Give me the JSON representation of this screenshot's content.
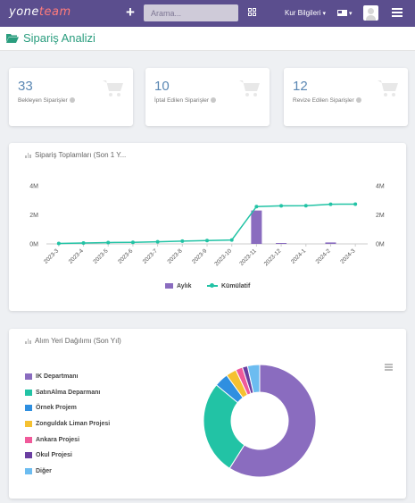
{
  "header": {
    "logo_part1": "yone",
    "logo_part2": "team",
    "search_placeholder": "Arama...",
    "company_menu": "Kur Bilgileri",
    "colors": {
      "topbar": "#5b4e8e",
      "accent": "#2a9d7e"
    }
  },
  "page": {
    "title": "Sipariş Analizi",
    "icon": "folder-open-icon"
  },
  "stats": [
    {
      "value": "33",
      "label": "Bekleyen Siparişler"
    },
    {
      "value": "10",
      "label": "İptal Edilen Siparişler"
    },
    {
      "value": "12",
      "label": "Revize Edilen Siparişler"
    }
  ],
  "order_chart": {
    "title": "Sipariş Toplamları (Son 1 Y...",
    "legend_monthly": "Aylık",
    "legend_cumulative": "Kümülatif"
  },
  "pie_chart": {
    "title": "Alım Yeri Dağılımı (Son Yıl)"
  },
  "chart_data": [
    {
      "type": "bar",
      "title": "Sipariş Toplamları (Son 1 Y...",
      "categories": [
        "2023-3",
        "2023-4",
        "2023-5",
        "2023-6",
        "2023-7",
        "2023-8",
        "2023-9",
        "2023-10",
        "2023-11",
        "2023-12",
        "2024-1",
        "2024-2",
        "2024-3"
      ],
      "y_ticks": [
        "0M",
        "2M",
        "4M"
      ],
      "ylim": [
        0,
        4000000
      ],
      "grid": false,
      "legend_position": "bottom",
      "series": [
        {
          "name": "Aylık",
          "type": "bar",
          "color": "#8a6cbf",
          "values": [
            0,
            0,
            0,
            0,
            0,
            0,
            0,
            0,
            2300000,
            20000,
            0,
            100000,
            0
          ]
        },
        {
          "name": "Kümülatif",
          "type": "line",
          "color": "#22c3a5",
          "values": [
            30000,
            60000,
            90000,
            110000,
            150000,
            190000,
            230000,
            270000,
            2570000,
            2620000,
            2630000,
            2730000,
            2740000
          ]
        }
      ]
    },
    {
      "type": "pie",
      "title": "Alım Yeri Dağılımı (Son Yıl)",
      "legend_position": "left",
      "donut": true,
      "labels": [
        "IK Departmanı",
        "SatınAlma Deparmanı",
        "Örnek Projem",
        "Zonguldak Liman Projesi",
        "Ankara Projesi",
        "Okul Projesi",
        "Diğer"
      ],
      "values": [
        59,
        27,
        4,
        3,
        2,
        1.5,
        3.5
      ],
      "colors": [
        "#8a6cbf",
        "#22c3a5",
        "#2f8fe0",
        "#f5c131",
        "#f05a9a",
        "#6a3ea1",
        "#6cbcf0"
      ]
    }
  ]
}
